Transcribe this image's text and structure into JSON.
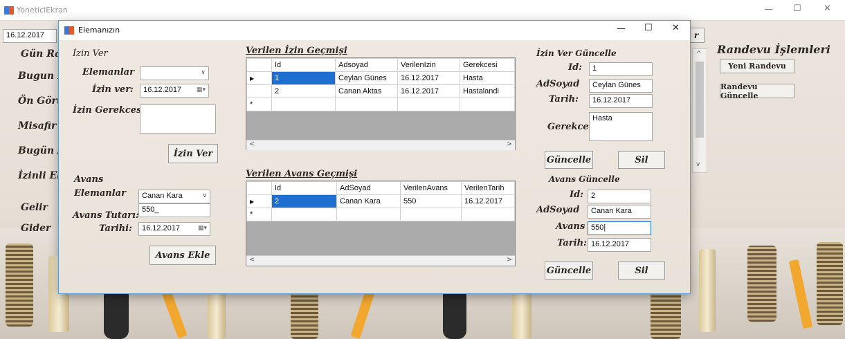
{
  "main": {
    "title": "YoneticiEkran",
    "date_field": "16.12.2017",
    "left_labels": [
      "Gün Ra",
      "Bugun R",
      "Ön Görü",
      "Misafir",
      "Bugün A",
      "İzinli El",
      "Gelir",
      "Gider"
    ],
    "right_section_title": "Randevu İşlemleri",
    "new_appointment": "Yeni Randevu",
    "update_appointment": "Randevu Güncelle",
    "partial_button": "r"
  },
  "dialog": {
    "title": "Elemanızın",
    "izin_ver": {
      "header": "İzin Ver",
      "employees_label": "Elemanlar",
      "employees_value": "",
      "date_label": "İzin ver:",
      "date_value": "16.12.2017",
      "reason_label": "İzin Gerekcesi",
      "reason_value": "",
      "button": "İzin Ver"
    },
    "avans": {
      "header": "Avans",
      "employees_label": "Elemanlar",
      "employees_value": "Canan Kara",
      "amount_label": "Avans Tutarı:",
      "amount_value": "550_",
      "date_label": "Tarihi:",
      "date_value": "16.12.2017",
      "button": "Avans Ekle"
    },
    "izin_history": {
      "title": "Verilen İzin Geçmişi",
      "columns": [
        "Id",
        "Adsoyad",
        "VerilenIzin",
        "Gerekcesi"
      ],
      "rows": [
        [
          "1",
          "Ceylan Günes",
          "16.12.2017",
          "Hasta"
        ],
        [
          "2",
          "Canan Aktas",
          "16.12.2017",
          "Hastalandi"
        ]
      ]
    },
    "avans_history": {
      "title": "Verilen Avans Geçmişi",
      "columns": [
        "Id",
        "AdSoyad",
        "VerilenAvans",
        "VerilenTarih"
      ],
      "rows": [
        [
          "2",
          "Canan Kara",
          "550",
          "16.12.2017"
        ]
      ]
    },
    "izin_update": {
      "header": "İzin Ver Güncelle",
      "id_label": "Id:",
      "id_value": "1",
      "name_label": "AdSoyad",
      "name_value": "Ceylan Günes",
      "date_label": "Tarih:",
      "date_value": "16.12.2017",
      "reason_label": "Gerekce",
      "reason_value": "Hasta",
      "update_button": "Güncelle",
      "delete_button": "Sil"
    },
    "avans_update": {
      "header": "Avans Güncelle",
      "id_label": "Id:",
      "id_value": "2",
      "name_label": "AdSoyad",
      "name_value": "Canan Kara",
      "amount_label": "Avans",
      "amount_value": "550",
      "date_label": "Tarih:",
      "date_value": "16.12.2017",
      "update_button": "Güncelle",
      "delete_button": "Sil"
    }
  }
}
